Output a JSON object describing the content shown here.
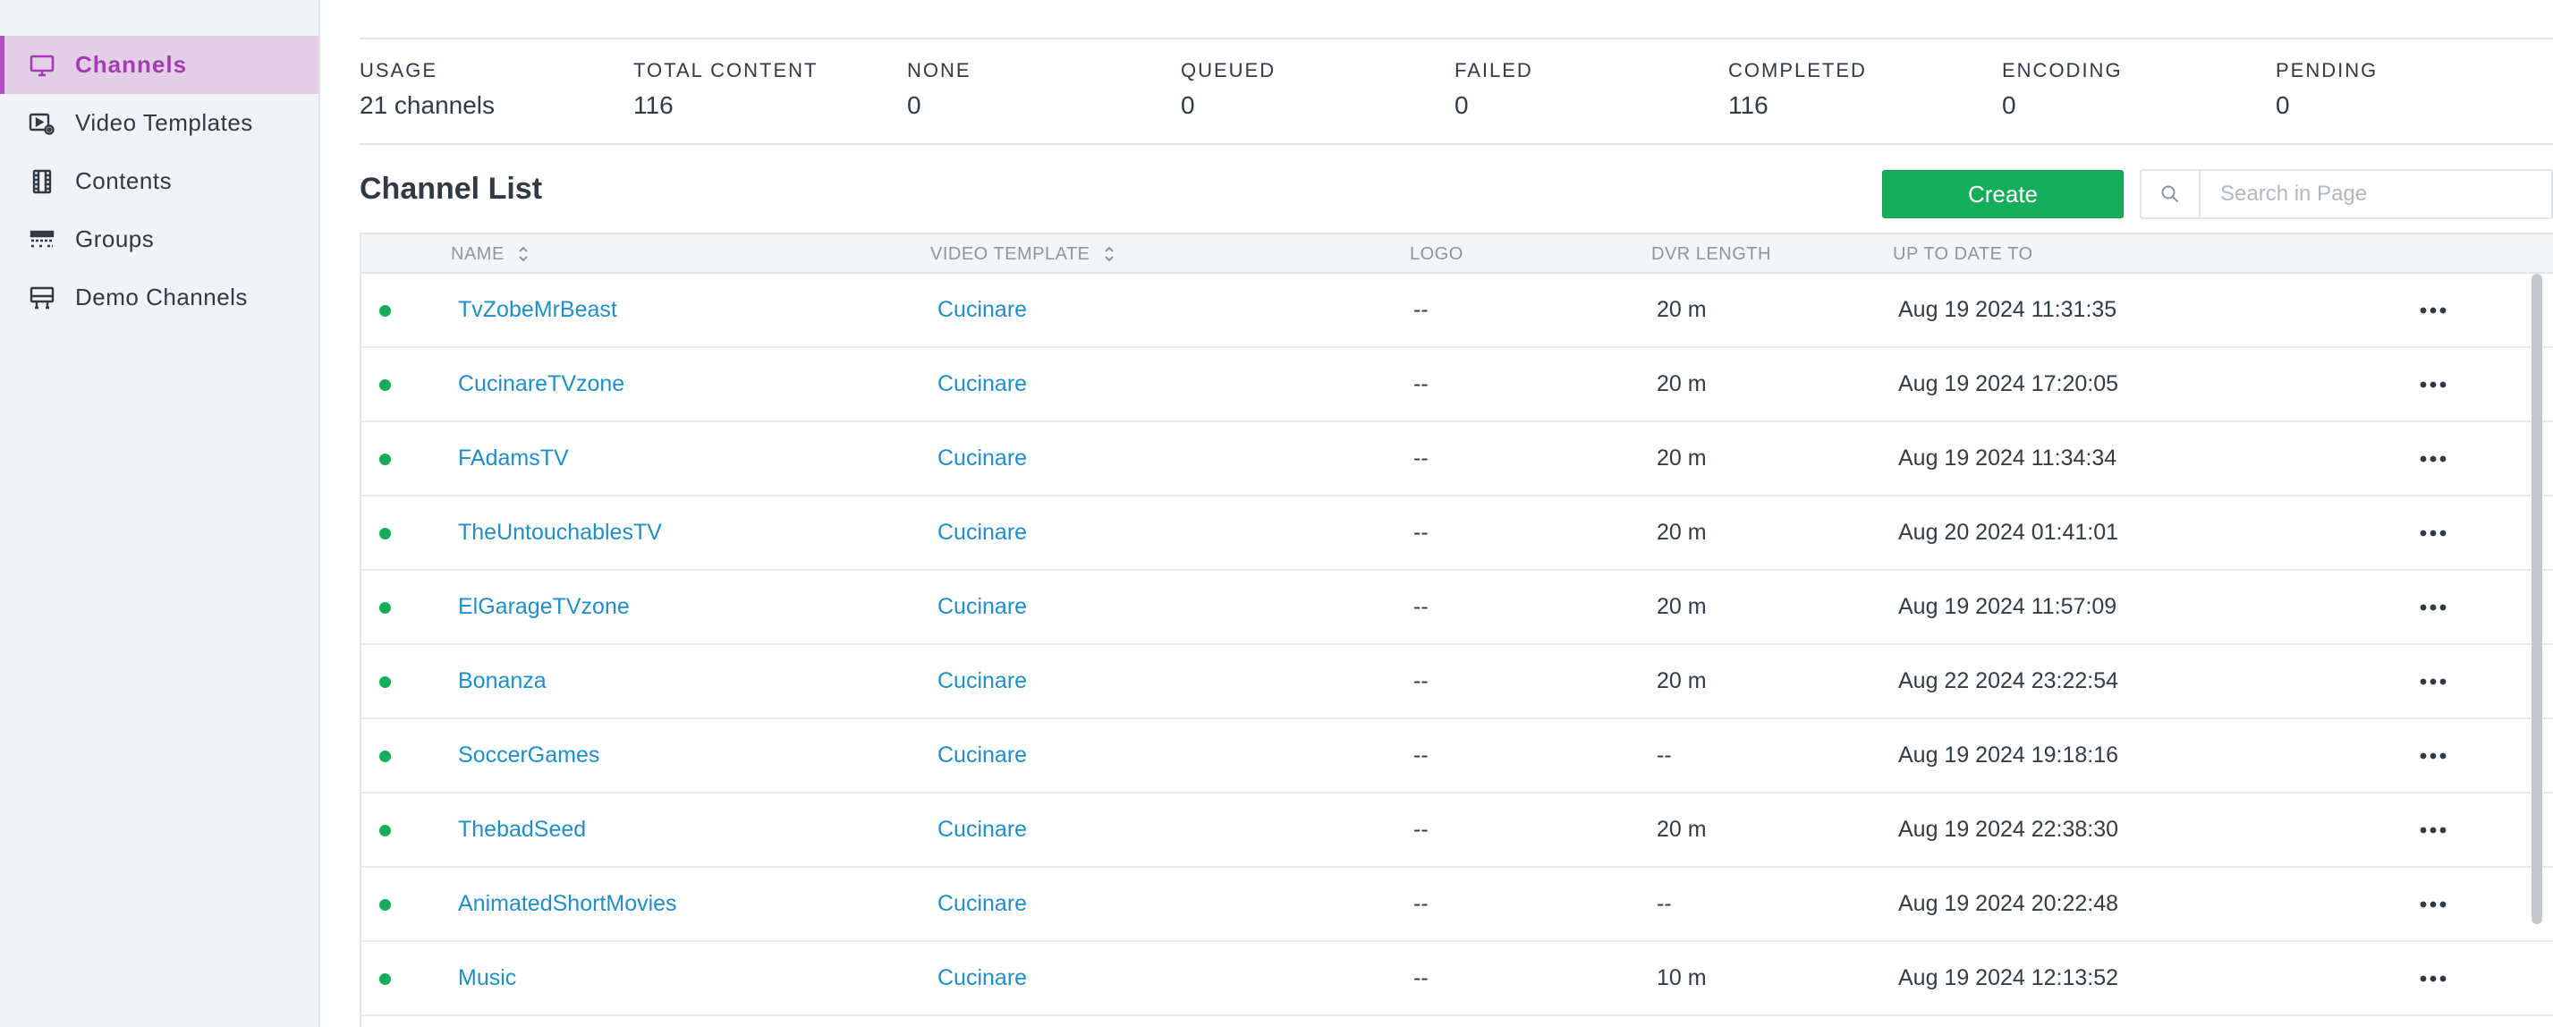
{
  "sidebar": {
    "items": [
      {
        "label": "Channels",
        "icon": "monitor-icon",
        "active": true
      },
      {
        "label": "Video Templates",
        "icon": "video-settings-icon",
        "active": false
      },
      {
        "label": "Contents",
        "icon": "film-strip-icon",
        "active": false
      },
      {
        "label": "Groups",
        "icon": "layers-icon",
        "active": false
      },
      {
        "label": "Demo Channels",
        "icon": "display-stand-icon",
        "active": false
      }
    ]
  },
  "stats": [
    {
      "label": "USAGE",
      "value": "21 channels"
    },
    {
      "label": "TOTAL CONTENT",
      "value": "116"
    },
    {
      "label": "NONE",
      "value": "0"
    },
    {
      "label": "QUEUED",
      "value": "0"
    },
    {
      "label": "FAILED",
      "value": "0"
    },
    {
      "label": "COMPLETED",
      "value": "116"
    },
    {
      "label": "ENCODING",
      "value": "0"
    },
    {
      "label": "PENDING",
      "value": "0"
    }
  ],
  "list": {
    "title": "Channel List",
    "create_label": "Create",
    "search_placeholder": "Search in Page"
  },
  "table": {
    "columns": [
      "NAME",
      "VIDEO TEMPLATE",
      "LOGO",
      "DVR LENGTH",
      "UP TO DATE TO"
    ],
    "rows": [
      {
        "name": "TvZobeMrBeast",
        "template": "Cucinare",
        "logo": "--",
        "dvr": "20 m",
        "updated": "Aug 19 2024 11:31:35"
      },
      {
        "name": "CucinareTVzone",
        "template": "Cucinare",
        "logo": "--",
        "dvr": "20 m",
        "updated": "Aug 19 2024 17:20:05"
      },
      {
        "name": "FAdamsTV",
        "template": "Cucinare",
        "logo": "--",
        "dvr": "20 m",
        "updated": "Aug 19 2024 11:34:34"
      },
      {
        "name": "TheUntouchablesTV",
        "template": "Cucinare",
        "logo": "--",
        "dvr": "20 m",
        "updated": "Aug 20 2024 01:41:01"
      },
      {
        "name": "ElGarageTVzone",
        "template": "Cucinare",
        "logo": "--",
        "dvr": "20 m",
        "updated": "Aug 19 2024 11:57:09"
      },
      {
        "name": "Bonanza",
        "template": "Cucinare",
        "logo": "--",
        "dvr": "20 m",
        "updated": "Aug 22 2024 23:22:54"
      },
      {
        "name": "SoccerGames",
        "template": "Cucinare",
        "logo": "--",
        "dvr": "--",
        "updated": "Aug 19 2024 19:18:16"
      },
      {
        "name": "ThebadSeed",
        "template": "Cucinare",
        "logo": "--",
        "dvr": "20 m",
        "updated": "Aug 19 2024 22:38:30"
      },
      {
        "name": "AnimatedShortMovies",
        "template": "Cucinare",
        "logo": "--",
        "dvr": "--",
        "updated": "Aug 19 2024 20:22:48"
      },
      {
        "name": "Music",
        "template": "Cucinare",
        "logo": "--",
        "dvr": "10 m",
        "updated": "Aug 19 2024 12:13:52"
      }
    ]
  },
  "colors": {
    "accent": "#a43bb5",
    "active_bg": "#e2cfe6",
    "create_button": "#16ad5a",
    "link": "#1f8ec9",
    "status_dot": "#16ad5a"
  }
}
